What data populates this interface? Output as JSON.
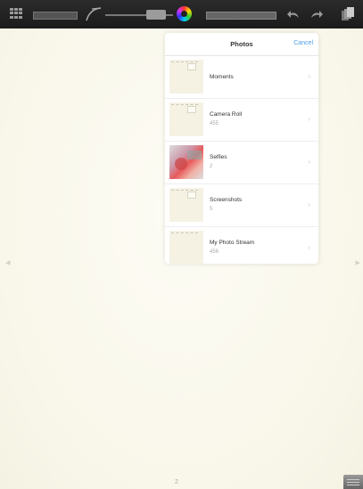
{
  "toolbar": {
    "icons": [
      "grid-icon",
      "eraser-bar",
      "pen-icon",
      "brush-size-slider",
      "color-wheel-icon",
      "opacity-bar",
      "undo-icon",
      "redo-icon",
      "layers-icon"
    ]
  },
  "canvas": {
    "page_number": "2",
    "left_arrow": "◂",
    "right_arrow": "▸"
  },
  "popover": {
    "title": "Photos",
    "cancel_label": "Cancel",
    "albums": [
      {
        "title": "Moments",
        "count": ""
      },
      {
        "title": "Camera Roll",
        "count": "455"
      },
      {
        "title": "Selfies",
        "count": "2"
      },
      {
        "title": "Screenshots",
        "count": "5"
      },
      {
        "title": "My Photo Stream",
        "count": "456"
      }
    ],
    "chevron": "›"
  },
  "colors": {
    "toolbar_bg": "#222222",
    "canvas_bg": "#fbf9ee",
    "accent_blue": "#4a9fe8"
  }
}
